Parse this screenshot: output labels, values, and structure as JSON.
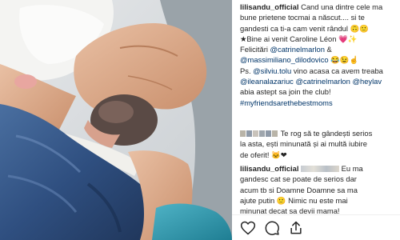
{
  "post": {
    "caption": {
      "username": "lilisandu_official",
      "line1": "Cand una dintre cele ma",
      "line2": "bune prietene tocmai a născut.... si te",
      "line3": "gandesti ca ti-a cam venit rândul 🙃🙂",
      "line4": "★Bine ai venit Caroline Léon 💗✨",
      "line5a": "Felicitări ",
      "mention1": "@catrinelmarlon",
      "line5b": " &",
      "mention2": "@massimiliano_dilodovico",
      "line6b": " 😂😉☝",
      "line7a": "Ps. ",
      "mention3": "@silviu.tolu",
      "line7b": " vino acasa ca avem treaba",
      "mention4": "@ileanalazariuc",
      "mention5": "@catrinelmarlon",
      "mention6": "@heylav",
      "line9": "abia astept sa join the club!",
      "hashtag": "#myfriendsarethebestmoms"
    },
    "comment1": {
      "line1": "Te rog să te gândești serios",
      "line2": "la asta, ești minunată și ai multă iubire",
      "line3": "de oferit! 🐱❤"
    },
    "comment2": {
      "username": "lilisandu_official",
      "line1": "Eu ma",
      "line2": "gandesc cat se poate de serios dar",
      "line3": "acum tb si Doamne Doamne sa ma",
      "line4": "ajute putin 🙂 Nimic nu este mai",
      "line5": "minunat decat sa devii mama!"
    }
  },
  "actions": {
    "like_icon": "heart-icon",
    "comment_icon": "comment-icon",
    "share_icon": "share-icon"
  },
  "colors": {
    "mention": "#003569",
    "text": "#262626",
    "divider": "#efefef"
  }
}
